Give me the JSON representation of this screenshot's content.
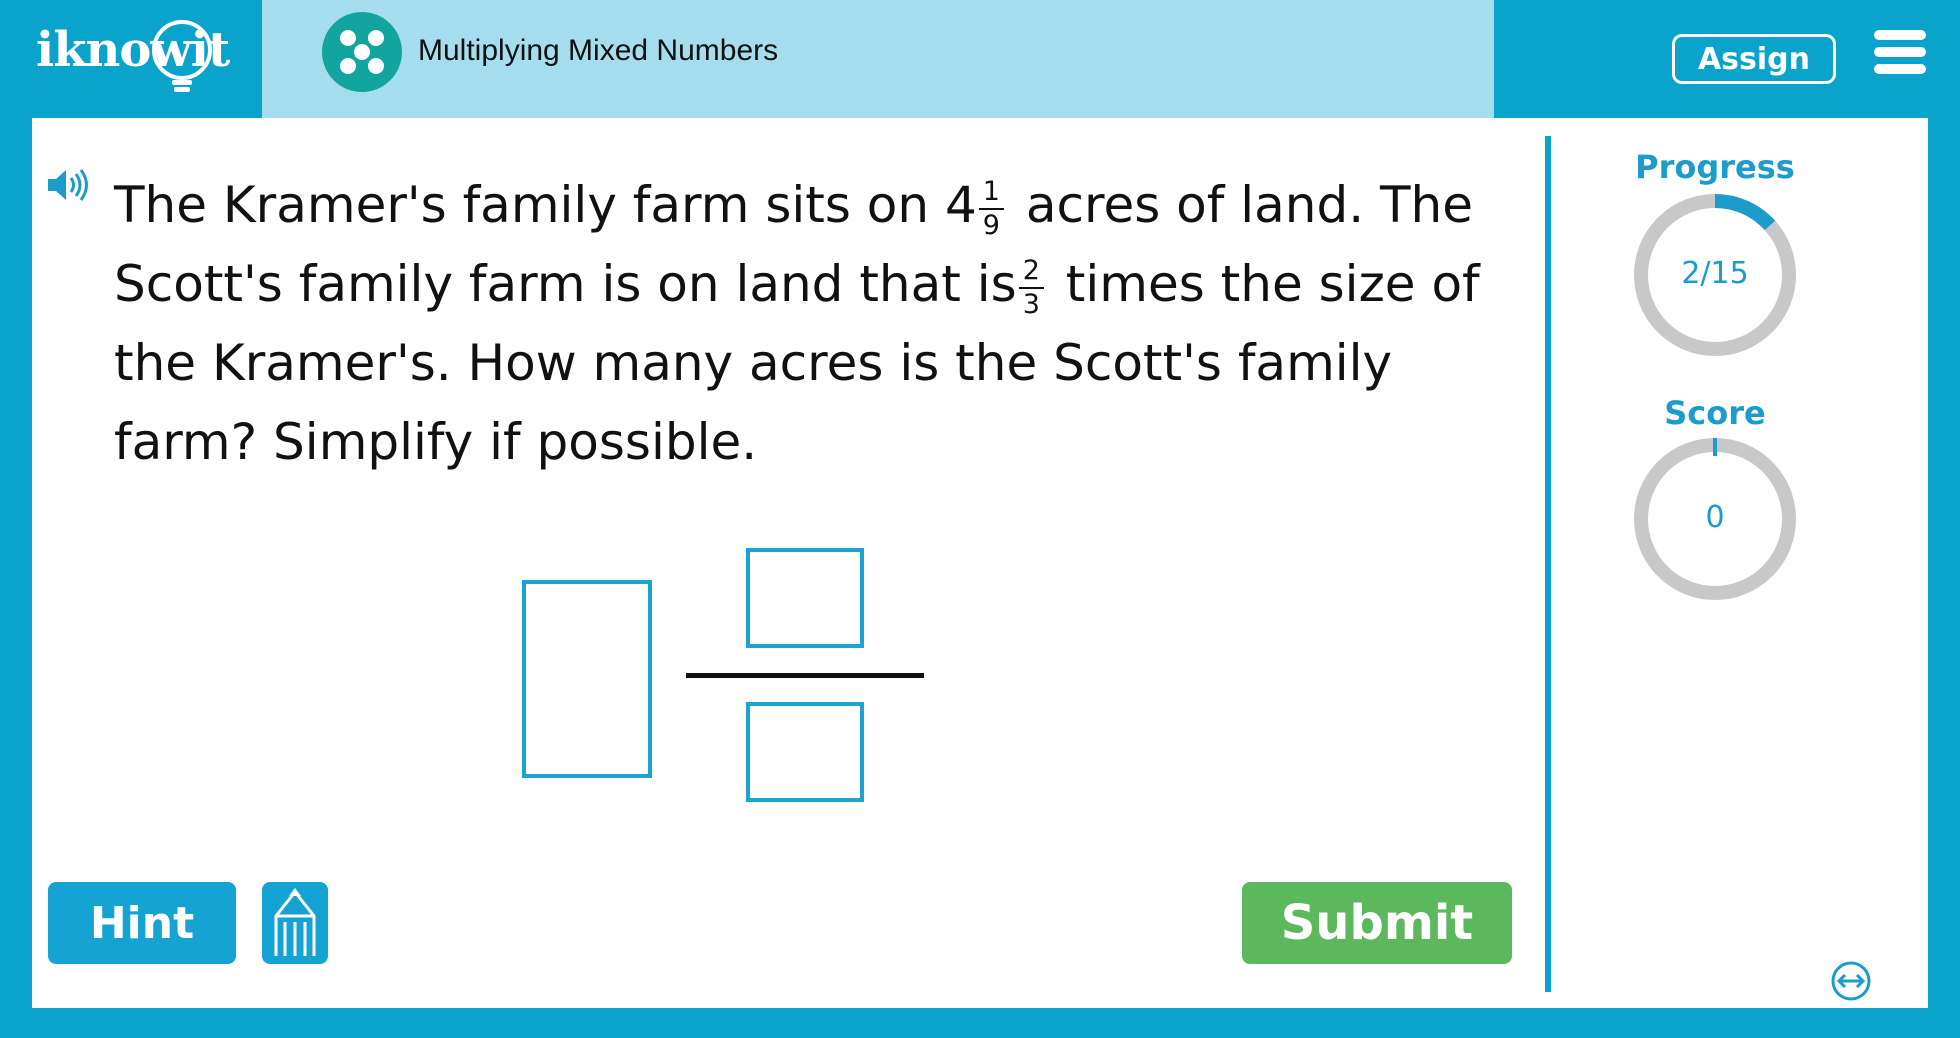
{
  "header": {
    "logo_text": "iknowit",
    "title": "Multiplying Mixed Numbers",
    "assign_label": "Assign",
    "icons": {
      "topic": "dice-five-icon",
      "menu": "hamburger-menu-icon"
    }
  },
  "question": {
    "part1": "The Kramer's family farm sits on 4",
    "frac1_num": "1",
    "frac1_den": "9",
    "part2": " acres of land. The Scott's family farm is on land that is",
    "frac2_num": "2",
    "frac2_den": "3",
    "part3": " times the size of the Kramer's. How many acres is the Scott's family farm? Simplify if possible."
  },
  "answer": {
    "whole": "",
    "numerator": "",
    "denominator": ""
  },
  "buttons": {
    "hint_label": "Hint",
    "submit_label": "Submit"
  },
  "sidebar": {
    "progress_label": "Progress",
    "progress_value": "2/15",
    "progress_fraction": 0.1333,
    "score_label": "Score",
    "score_value": "0",
    "score_fraction": 0
  },
  "colors": {
    "accent": "#0aa3cc",
    "submit": "#5cb85c",
    "ring_track": "#c8c8c8",
    "pill": "#a5dcee"
  }
}
